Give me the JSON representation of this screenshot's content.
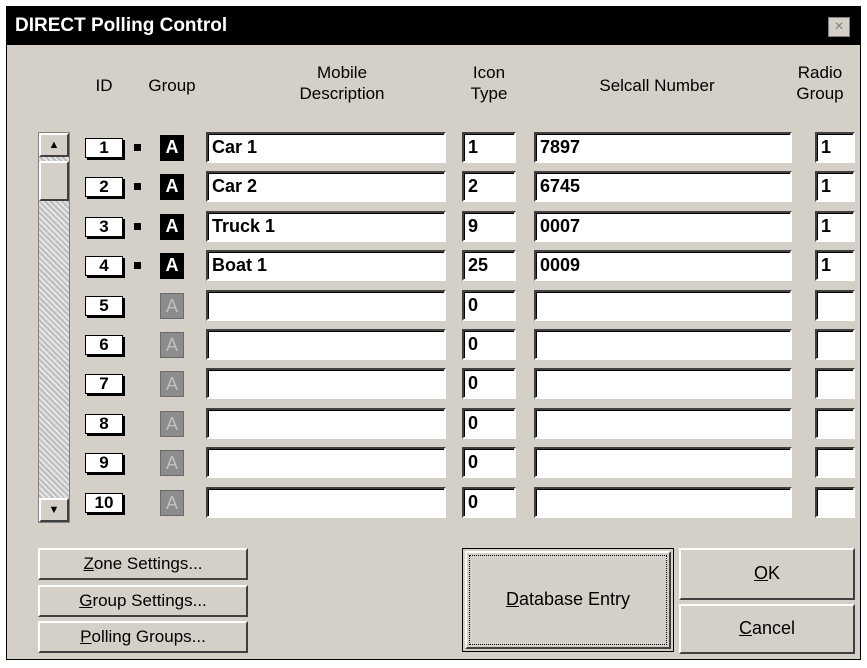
{
  "window": {
    "title": "DIRECT Polling Control",
    "close_glyph": "×"
  },
  "headers": {
    "id": "ID",
    "group": "Group",
    "mobile_description": [
      "Mobile",
      "Description"
    ],
    "icon_type": [
      "Icon",
      "Type"
    ],
    "selcall_number": "Selcall Number",
    "radio_group": [
      "Radio",
      "Group"
    ]
  },
  "scrollbar": {
    "up_glyph": "▲",
    "down_glyph": "▼"
  },
  "rows": [
    {
      "id": "1",
      "group": "A",
      "active": true,
      "description": "Car 1",
      "icon_type": "1",
      "selcall": "7897",
      "radio_group": "1"
    },
    {
      "id": "2",
      "group": "A",
      "active": true,
      "description": "Car 2",
      "icon_type": "2",
      "selcall": "6745",
      "radio_group": "1"
    },
    {
      "id": "3",
      "group": "A",
      "active": true,
      "description": "Truck 1",
      "icon_type": "9",
      "selcall": "0007",
      "radio_group": "1"
    },
    {
      "id": "4",
      "group": "A",
      "active": true,
      "description": "Boat 1",
      "icon_type": "25",
      "selcall": "0009",
      "radio_group": "1"
    },
    {
      "id": "5",
      "group": "A",
      "active": false,
      "description": "",
      "icon_type": "0",
      "selcall": "",
      "radio_group": ""
    },
    {
      "id": "6",
      "group": "A",
      "active": false,
      "description": "",
      "icon_type": "0",
      "selcall": "",
      "radio_group": ""
    },
    {
      "id": "7",
      "group": "A",
      "active": false,
      "description": "",
      "icon_type": "0",
      "selcall": "",
      "radio_group": ""
    },
    {
      "id": "8",
      "group": "A",
      "active": false,
      "description": "",
      "icon_type": "0",
      "selcall": "",
      "radio_group": ""
    },
    {
      "id": "9",
      "group": "A",
      "active": false,
      "description": "",
      "icon_type": "0",
      "selcall": "",
      "radio_group": ""
    },
    {
      "id": "10",
      "group": "A",
      "active": false,
      "description": "",
      "icon_type": "0",
      "selcall": "",
      "radio_group": ""
    }
  ],
  "buttons": {
    "zone_settings": {
      "mnemonic": "Z",
      "rest": "one Settings..."
    },
    "group_settings": {
      "mnemonic": "G",
      "rest": "roup Settings..."
    },
    "polling_groups": {
      "mnemonic": "P",
      "rest": "olling Groups..."
    },
    "database_entry": {
      "mnemonic": "D",
      "rest": "atabase Entry"
    },
    "ok": {
      "mnemonic": "O",
      "rest": "K"
    },
    "cancel": {
      "mnemonic": "C",
      "rest": "ancel"
    }
  }
}
